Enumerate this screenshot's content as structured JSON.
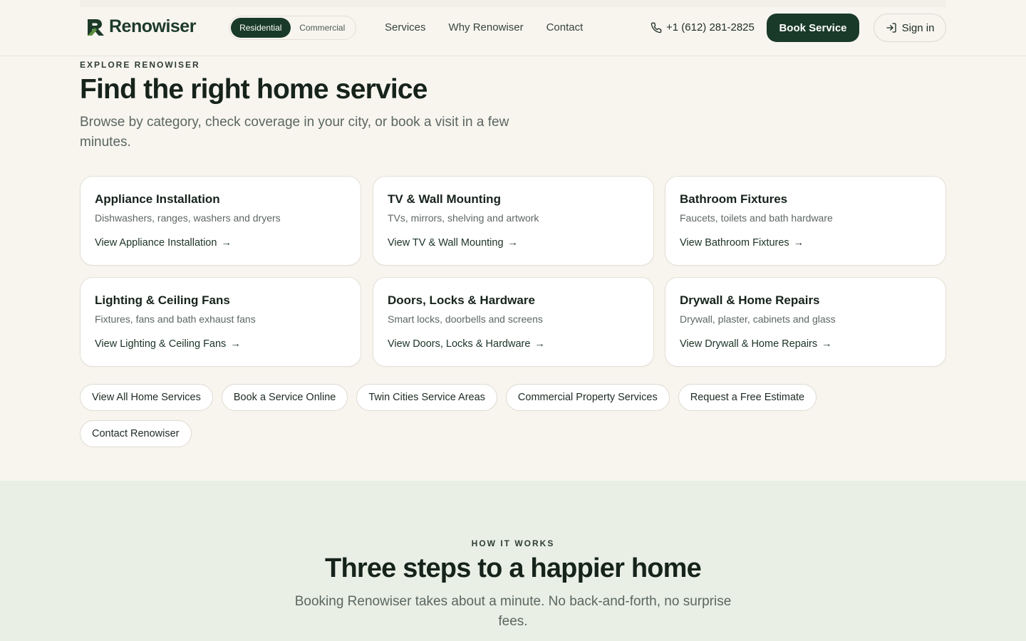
{
  "brand": {
    "name": "Renowiser",
    "color": "#1a3a29",
    "accent": "#5b8f3e"
  },
  "header": {
    "segments": [
      {
        "label": "Residential",
        "active": true
      },
      {
        "label": "Commercial",
        "active": false
      }
    ],
    "nav": [
      "Services",
      "Why Renowiser",
      "Contact"
    ],
    "phone": {
      "icon": "phone-icon",
      "number": "+1 (612) 281-2825"
    },
    "book_label": "Book Service",
    "signin": {
      "icon": "sign-in-icon",
      "label": "Sign in"
    }
  },
  "explore": {
    "eyebrow": "EXPLORE RENOWISER",
    "title": "Find the right home service",
    "subtitle": "Browse by category, check coverage in your city, or book a visit in a few minutes.",
    "cards": [
      {
        "title": "Appliance Installation",
        "desc": "Dishwashers, ranges, washers and dryers",
        "link": "View Appliance Installation"
      },
      {
        "title": "TV & Wall Mounting",
        "desc": "TVs, mirrors, shelving and artwork",
        "link": "View TV & Wall Mounting"
      },
      {
        "title": "Bathroom Fixtures",
        "desc": "Faucets, toilets and bath hardware",
        "link": "View Bathroom Fixtures"
      },
      {
        "title": "Lighting & Ceiling Fans",
        "desc": "Fixtures, fans and bath exhaust fans",
        "link": "View Lighting & Ceiling Fans"
      },
      {
        "title": "Doors, Locks & Hardware",
        "desc": "Smart locks, doorbells and screens",
        "link": "View Doors, Locks & Hardware"
      },
      {
        "title": "Drywall & Home Repairs",
        "desc": "Drywall, plaster, cabinets and glass",
        "link": "View Drywall & Home Repairs"
      }
    ],
    "link_arrow": "→",
    "pills": [
      "View All Home Services",
      "Book a Service Online",
      "Twin Cities Service Areas",
      "Commercial Property Services",
      "Request a Free Estimate",
      "Contact Renowiser"
    ]
  },
  "how": {
    "eyebrow": "HOW IT WORKS",
    "title": "Three steps to a happier home",
    "subtitle": "Booking Renowiser takes about a minute. No back-and-forth, no surprise fees."
  }
}
